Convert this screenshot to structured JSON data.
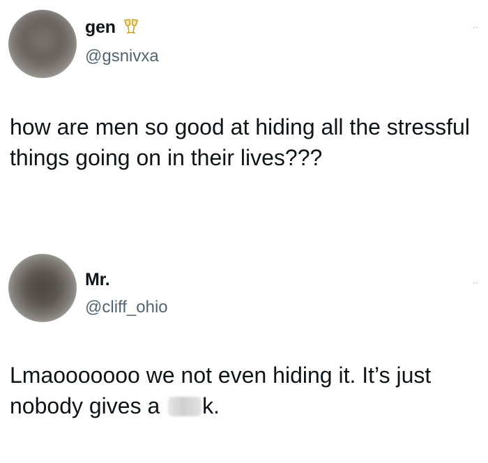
{
  "tweets": [
    {
      "display_name": "gen",
      "name_emoji_icon": "champagne-glasses-icon",
      "handle": "@gsnivxa",
      "more_label": "··",
      "text": "how are men so good at hiding all the stressful things going on in their lives???"
    },
    {
      "display_name": "Mr.",
      "handle": "@cliff_ohio",
      "more_label": "··",
      "text_before": "Lmaooooooo we not even hiding it. It’s just nobody gives a ",
      "text_after": "k."
    }
  ]
}
